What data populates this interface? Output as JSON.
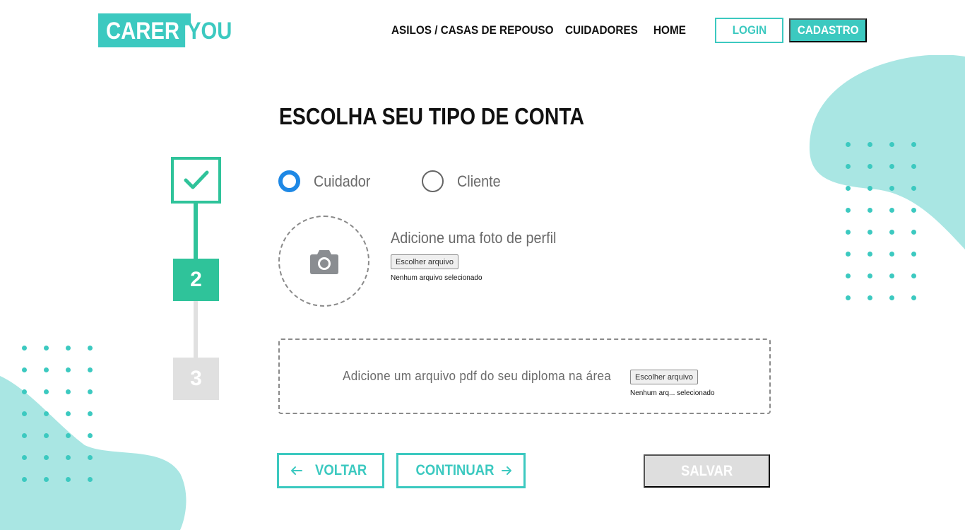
{
  "colors": {
    "brand": "#3cc9c0",
    "step_active": "#2fc39a",
    "step_inactive": "#e0e0e0",
    "radio_selected": "#1e88e5",
    "blob": "#a9e6e3"
  },
  "header": {
    "logo_part1": "CARER",
    "logo_part2": "YOU",
    "nav": [
      "ASILOS / CASAS DE REPOUSO",
      "CUIDADORES",
      "HOME"
    ],
    "login_label": "LOGIN",
    "signup_label": "CADASTRO"
  },
  "main": {
    "title": "ESCOLHA SEU TIPO DE CONTA",
    "stepper": {
      "steps": [
        {
          "state": "completed",
          "icon": "check-icon"
        },
        {
          "label": "2",
          "state": "active"
        },
        {
          "label": "3",
          "state": "inactive"
        }
      ]
    },
    "account_type": {
      "options": [
        "Cuidador",
        "Cliente"
      ],
      "selected": "Cuidador"
    },
    "profile_photo": {
      "icon": "camera-icon",
      "label": "Adicione uma foto de perfil",
      "button_label": "Escolher arquivo",
      "status": "Nenhum arquivo selecionado"
    },
    "diploma": {
      "label": "Adicione um arquivo pdf do seu diploma na área",
      "button_label": "Escolher arquivo",
      "status": "Nenhum arq... selecionado"
    },
    "actions": {
      "back_label": "VOLTAR",
      "continue_label": "CONTINUAR",
      "save_label": "SALVAR"
    }
  }
}
